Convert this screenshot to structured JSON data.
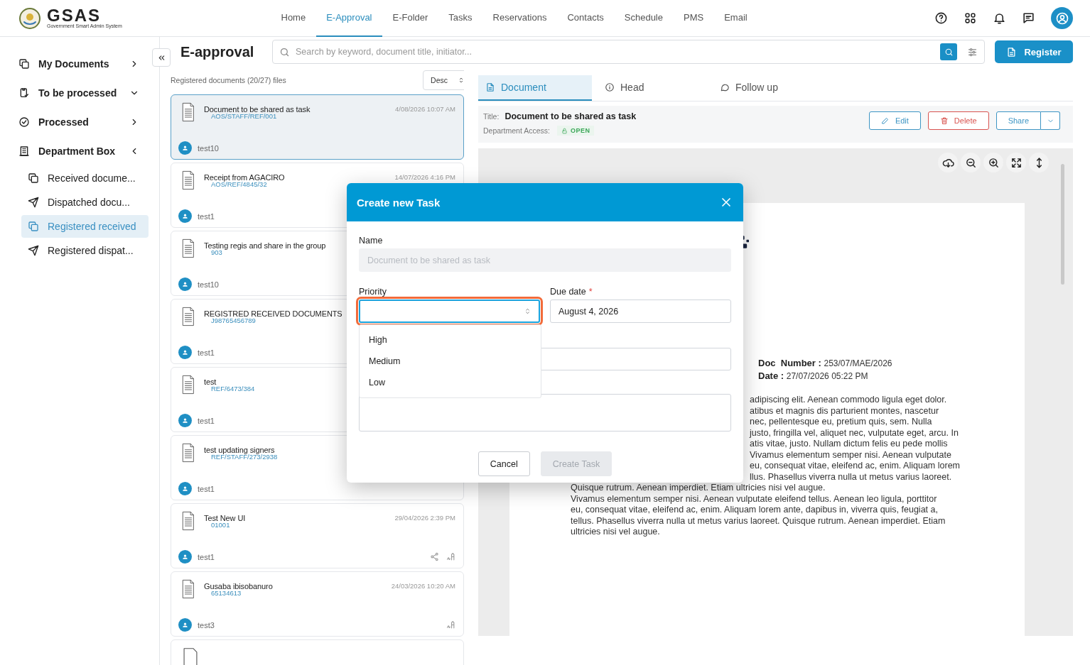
{
  "header": {
    "logo": {
      "name": "GSAS",
      "tagline": "Government Smart Admin System"
    },
    "nav": [
      {
        "label": "Home",
        "selected": false
      },
      {
        "label": "E-Approval",
        "selected": true
      },
      {
        "label": "E-Folder",
        "selected": false
      },
      {
        "label": "Tasks",
        "selected": false
      },
      {
        "label": "Reservations",
        "selected": false
      },
      {
        "label": "Contacts",
        "selected": false
      },
      {
        "label": "Schedule",
        "selected": false
      },
      {
        "label": "PMS",
        "selected": false
      },
      {
        "label": "Email",
        "selected": false
      }
    ]
  },
  "sidebar": {
    "items": [
      {
        "label": "My Documents",
        "selected": false
      },
      {
        "label": "To be processed",
        "selected": false
      },
      {
        "label": "Processed",
        "selected": false
      },
      {
        "label": "Department Box",
        "selected": false,
        "children": [
          {
            "label": "Received docume...",
            "selected": false
          },
          {
            "label": "Dispatched docu...",
            "selected": false
          },
          {
            "label": "Registered received",
            "selected": true
          },
          {
            "label": "Registered dispat...",
            "selected": false
          }
        ]
      }
    ]
  },
  "page": {
    "title": "E-approval",
    "search_placeholder": "Search by keyword, document title, initiator...",
    "register": "Register"
  },
  "list": {
    "summary": "Registered documents (20/27) files",
    "sort": "Desc",
    "cards": [
      {
        "title": "Document to be shared as task",
        "date": "4/08/2026 10:07 AM",
        "ref": "AOS/STAFF/REF/001",
        "user": "test10",
        "selected": true,
        "share_action": false,
        "sign_action": false
      },
      {
        "title": "Receipt from AGACIRO",
        "date": "14/07/2026 4:16 PM",
        "ref": "AOS/REF/4845/32",
        "user": "test1",
        "selected": false,
        "share_action": false,
        "sign_action": false
      },
      {
        "title": "Testing regis and share in the group",
        "ref": "903",
        "user": "test10",
        "selected": false,
        "share_action": false,
        "sign_action": false
      },
      {
        "title": "REGISTRED RECEIVED DOCUMENTS",
        "ref": "J98765456789",
        "user": "test1",
        "selected": false,
        "share_action": false,
        "sign_action": false
      },
      {
        "title": "test",
        "ref": "REF/6473/384",
        "user": "test1",
        "selected": false,
        "share_action": false,
        "sign_action": false
      },
      {
        "title": "test updating signers",
        "ref": "REF/STAFF/273/2938",
        "user": "test1",
        "selected": false,
        "share_action": false,
        "sign_action": false
      },
      {
        "title": "Test New UI",
        "date": "29/04/2026 2:39 PM",
        "ref": "01001",
        "user": "test1",
        "selected": false,
        "share_action": true,
        "sign_action": true
      },
      {
        "title": "Gusaba ibisobanuro",
        "date": "24/03/2026 10:20 AM",
        "ref": "65134613",
        "user": "test3",
        "selected": false,
        "share_action": false,
        "sign_action": true
      }
    ]
  },
  "viewer": {
    "tabs": [
      {
        "label": "Document",
        "selected": true
      },
      {
        "label": "Head",
        "selected": false
      },
      {
        "label": "Follow up",
        "selected": false
      }
    ],
    "title_label": "Title:",
    "title": "Document to be shared as task",
    "access_label": "Department Access:",
    "access": "OPEN",
    "buttons": [
      {
        "label": "Edit",
        "kind": "edit"
      },
      {
        "label": "Delete",
        "kind": "delete"
      },
      {
        "label": "Share",
        "kind": "share"
      }
    ],
    "doc": {
      "number_label": "Doc  Number :",
      "number": "253/07/MAE/2026",
      "date_label": "Date :",
      "date": "27/07/2026 05:22 PM",
      "lines_beside_dialog": [
        "adipiscing elit. Aenean commodo ligula eget dolor.",
        "atibus et magnis dis parturient montes, nascetur",
        "nec, pellentesque eu, pretium quis, sem. Nulla",
        "justo, fringilla vel, aliquet nec, vulputate eget, arcu. In",
        "atis vitae, justo. Nullam dictum felis eu pede mollis",
        "Vivamus elementum semper nisi. Aenean vulputate",
        "eu, consequat vitae, eleifend ac, enim. Aliquam lorem",
        "llus. Phasellus viverra nulla ut metus varius laoreet."
      ],
      "lines": [
        "Quisque rutrum. Aenean imperdiet. Etiam ultricies nisi vel augue.",
        "Vivamus elementum semper nisi. Aenean vulputate eleifend tellus. Aenean leo ligula, porttitor",
        "eu, consequat vitae, eleifend ac, enim. Aliquam lorem ante, dapibus in, viverra quis, feugiat a,",
        "tellus. Phasellus viverra nulla ut metus varius laoreet. Quisque rutrum. Aenean imperdiet. Etiam",
        "ultricies nisi vel augue."
      ]
    }
  },
  "modal": {
    "title": "Create new Task",
    "name_label": "Name",
    "name_value": "Document to be shared as task",
    "name_disabled": true,
    "priority_label": "Priority",
    "due_label": "Due date",
    "due_required_mark": "*",
    "due_value": "August 4, 2026",
    "options": [
      "High",
      "Medium",
      "Low"
    ],
    "buttons": [
      {
        "label": "Cancel",
        "disabled": false
      },
      {
        "label": "Create Task",
        "disabled": true
      }
    ]
  }
}
